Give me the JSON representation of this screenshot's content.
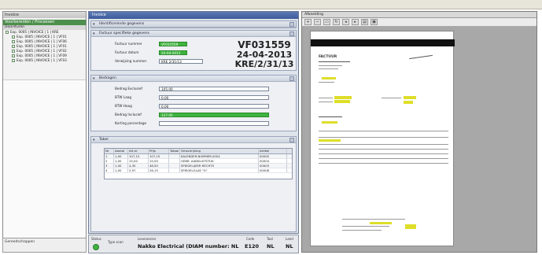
{
  "left_panel": {
    "title": "Invoice",
    "subtitle": "Voorbereiden / Processen",
    "header": "Doorsturen",
    "items": [
      {
        "label": "Exp. 0005 | INVOICE | 1 | KRE",
        "level": "root"
      },
      {
        "label": "Exp. 0005 | INVOICE | 1 | VF01",
        "level": "child"
      },
      {
        "label": "Exp. 0005 | INVOICE | 1 | VF06",
        "level": "child"
      },
      {
        "label": "Exp. 0005 | INVOICE | 1 | VF01",
        "level": "child"
      },
      {
        "label": "Exp. 0005 | INVOICE | 1 | VF02",
        "level": "child"
      },
      {
        "label": "Exp. 0005 | INVOICE | 1 | VF09",
        "level": "child"
      },
      {
        "label": "Exp. 0005 | INVOICE | 1 | VF03",
        "level": "child"
      }
    ],
    "bottom_label": "Gereedschappen"
  },
  "dialog": {
    "title": "Invoice",
    "sections": {
      "identification": "Identificerende gegevens",
      "invoice": "Factuur specifieke gegevens",
      "amounts": "Bedragen",
      "table": "Tabel"
    },
    "invoice_fields": [
      {
        "label": "Factuur nummer",
        "value": "VF031559",
        "green": true
      },
      {
        "label": "Factuur datum",
        "value": "24-04-2013",
        "green": true
      },
      {
        "label": "Verwijzing nummer",
        "value": "KRE 2/31/13",
        "green": false
      }
    ],
    "big_number": "VF031559",
    "big_date": "24-04-2013",
    "big_ref": "KRE/2/31/13",
    "amount_fields": [
      {
        "label": "Bedrag Exclusief",
        "value": "105,00",
        "green": false
      },
      {
        "label": "BTW Laag",
        "value": "0,00",
        "green": false
      },
      {
        "label": "BTW Hoog",
        "value": "0,00",
        "green": false
      },
      {
        "label": "Bedrag Inclusief",
        "value": "127,05",
        "green": true
      },
      {
        "label": "Korting percentage",
        "value": "",
        "green": false
      }
    ],
    "table": {
      "columns": [
        "Nr",
        "Aantal",
        "Art.nr",
        "Prijs",
        "Totaal",
        "Omschrijving",
        "Artikel"
      ],
      "rows": [
        [
          "1",
          "1,00",
          "107,15",
          "107,15",
          "",
          "KALENDER-NUMMER-0004",
          "00005"
        ],
        [
          "2",
          "1,00",
          "15,00",
          "15,00",
          "",
          "GEBR. AANSLUITSTUK",
          "00004"
        ],
        [
          "3",
          "1,00",
          "4,30",
          "48,50",
          "",
          "SPIEGELIJZER RECHTS",
          "00003"
        ],
        [
          "4",
          "1,00",
          "2,97",
          "26,15",
          "",
          "SPIEGELGLAS \"G\"",
          "00008"
        ]
      ]
    }
  },
  "dialog_bottom": {
    "status_label": "Status",
    "type_label": "Type scan",
    "supplier_label": "Leverancier",
    "supplier_value": "Nakko Electrical (DIAM number: NL",
    "code_label": "Code",
    "code_value": "E120",
    "land_label": "Taal",
    "land_value": "NL",
    "lang_label": "Land",
    "lang_value": "NL"
  },
  "preview": {
    "title": "Afbeelding",
    "doc_title": "FACTUUR"
  },
  "colors": {
    "accent_green": "#3fb43f",
    "title_blue": "#3d5c9b",
    "highlight_yellow": "#dede2a"
  }
}
